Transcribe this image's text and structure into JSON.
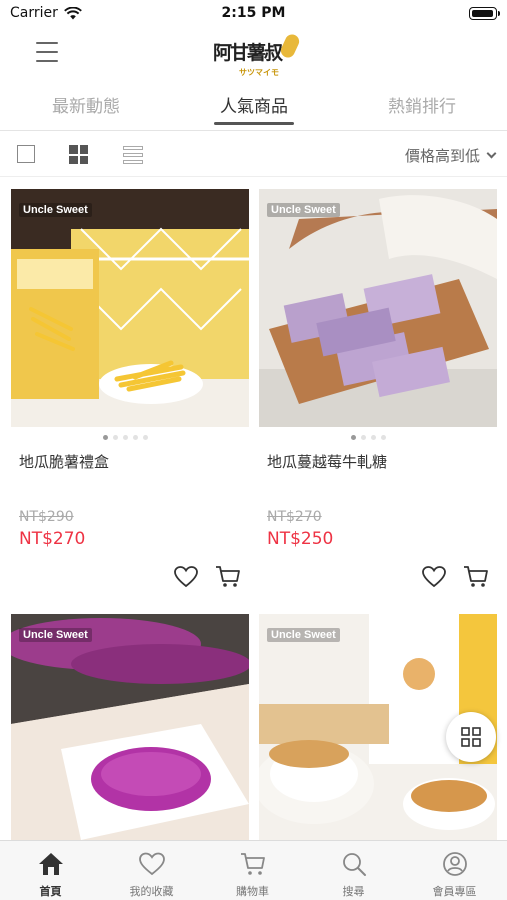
{
  "status_bar": {
    "carrier": "Carrier",
    "time": "2:15 PM"
  },
  "header": {
    "logo_text": "阿甘薯叔",
    "logo_sub": "サツマイモ"
  },
  "tabs": [
    {
      "label": "最新動態",
      "active": false
    },
    {
      "label": "人氣商品",
      "active": true
    },
    {
      "label": "熱銷排行",
      "active": false
    }
  ],
  "toolbar": {
    "views": [
      "single-view-icon",
      "grid-view-icon",
      "list-view-icon"
    ],
    "selected_view": "grid-view-icon",
    "sort_label": "價格高到低"
  },
  "products": [
    {
      "brand": "Uncle Sweet",
      "name": "地瓜脆薯禮盒",
      "old_price": "NT$290",
      "price": "NT$270",
      "image_slide": 1,
      "image_slides_total": 5
    },
    {
      "brand": "Uncle Sweet",
      "name": "地瓜蔓越莓牛軋糖",
      "old_price": "NT$270",
      "price": "NT$250",
      "image_slide": 1,
      "image_slides_total": 4
    },
    {
      "brand": "Uncle Sweet",
      "name": "",
      "old_price": "",
      "price": ""
    },
    {
      "brand": "Uncle Sweet",
      "name": "",
      "old_price": "",
      "price": ""
    }
  ],
  "bottom_nav": [
    {
      "label": "首頁",
      "icon": "home-icon",
      "active": true
    },
    {
      "label": "我的收藏",
      "icon": "heart-icon",
      "active": false
    },
    {
      "label": "購物車",
      "icon": "cart-icon",
      "active": false
    },
    {
      "label": "搜尋",
      "icon": "search-icon",
      "active": false
    },
    {
      "label": "會員專區",
      "icon": "user-icon",
      "active": false
    }
  ],
  "colors": {
    "price": "#ee3344",
    "accent_active": "#333333",
    "inactive": "#aaaaaa"
  }
}
